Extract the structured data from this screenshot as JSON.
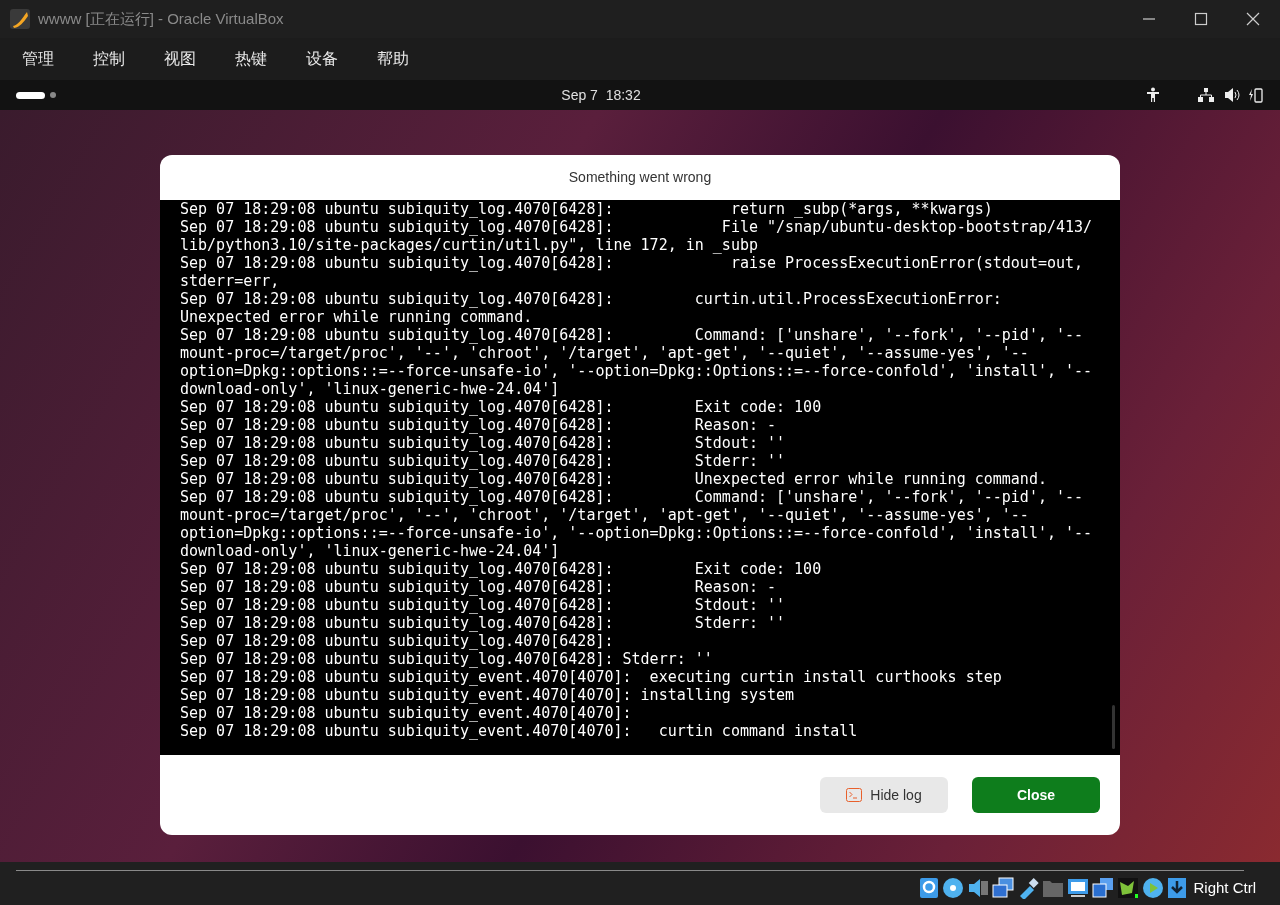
{
  "window": {
    "title": "wwww [正在运行] - Oracle VirtualBox"
  },
  "menu": [
    "管理",
    "控制",
    "视图",
    "热键",
    "设备",
    "帮助"
  ],
  "top_bar": {
    "clock": "Sep 7  18:32"
  },
  "dialog": {
    "title": "Something went wrong",
    "log_lines": [
      "Sep 07 18:29:08 ubuntu subiquity_log.4070[6428]:             return _subp(*args, **kwargs)",
      "Sep 07 18:29:08 ubuntu subiquity_log.4070[6428]:            File \"/snap/ubuntu-desktop-bootstrap/413/",
      "lib/python3.10/site-packages/curtin/util.py\", line 172, in _subp",
      "Sep 07 18:29:08 ubuntu subiquity_log.4070[6428]:             raise ProcessExecutionError(stdout=out,",
      "stderr=err,",
      "Sep 07 18:29:08 ubuntu subiquity_log.4070[6428]:         curtin.util.ProcessExecutionError:",
      "Unexpected error while running command.",
      "Sep 07 18:29:08 ubuntu subiquity_log.4070[6428]:         Command: ['unshare', '--fork', '--pid', '--",
      "mount-proc=/target/proc', '--', 'chroot', '/target', 'apt-get', '--quiet', '--assume-yes', '--",
      "option=Dpkg::options::=--force-unsafe-io', '--option=Dpkg::Options::=--force-confold', 'install', '--",
      "download-only', 'linux-generic-hwe-24.04']",
      "Sep 07 18:29:08 ubuntu subiquity_log.4070[6428]:         Exit code: 100",
      "Sep 07 18:29:08 ubuntu subiquity_log.4070[6428]:         Reason: -",
      "Sep 07 18:29:08 ubuntu subiquity_log.4070[6428]:         Stdout: ''",
      "Sep 07 18:29:08 ubuntu subiquity_log.4070[6428]:         Stderr: ''",
      "Sep 07 18:29:08 ubuntu subiquity_log.4070[6428]:         Unexpected error while running command.",
      "Sep 07 18:29:08 ubuntu subiquity_log.4070[6428]:         Command: ['unshare', '--fork', '--pid', '--",
      "mount-proc=/target/proc', '--', 'chroot', '/target', 'apt-get', '--quiet', '--assume-yes', '--",
      "option=Dpkg::options::=--force-unsafe-io', '--option=Dpkg::Options::=--force-confold', 'install', '--",
      "download-only', 'linux-generic-hwe-24.04']",
      "Sep 07 18:29:08 ubuntu subiquity_log.4070[6428]:         Exit code: 100",
      "Sep 07 18:29:08 ubuntu subiquity_log.4070[6428]:         Reason: -",
      "Sep 07 18:29:08 ubuntu subiquity_log.4070[6428]:         Stdout: ''",
      "Sep 07 18:29:08 ubuntu subiquity_log.4070[6428]:         Stderr: ''",
      "Sep 07 18:29:08 ubuntu subiquity_log.4070[6428]:",
      "Sep 07 18:29:08 ubuntu subiquity_log.4070[6428]: Stderr: ''",
      "Sep 07 18:29:08 ubuntu subiquity_event.4070[4070]:  executing curtin install curthooks step",
      "Sep 07 18:29:08 ubuntu subiquity_event.4070[4070]: installing system",
      "Sep 07 18:29:08 ubuntu subiquity_event.4070[4070]:",
      "Sep 07 18:29:08 ubuntu subiquity_event.4070[4070]:   curtin command install"
    ],
    "buttons": [
      {
        "kind": "secondary",
        "label": "Hide log"
      },
      {
        "kind": "primary",
        "label": "Close"
      }
    ]
  },
  "status_bar": {
    "host_key": "Right Ctrl"
  }
}
